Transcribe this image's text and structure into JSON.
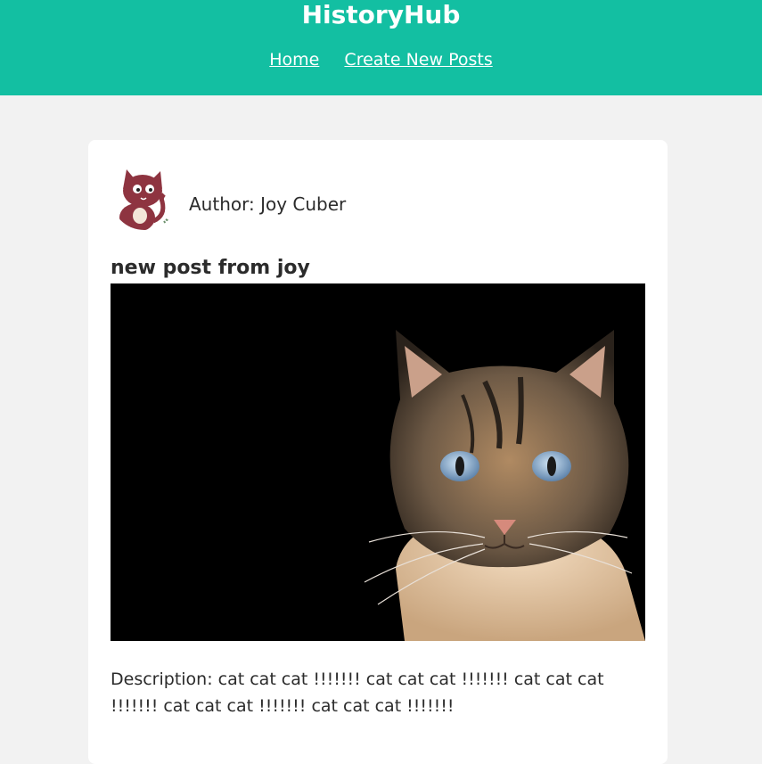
{
  "header": {
    "brand": "HistoryHub",
    "nav": {
      "home": "Home",
      "create": "Create New Posts"
    }
  },
  "post": {
    "author_line": "Author: Joy Cuber",
    "title": "new post from joy",
    "description": "Description: cat cat cat !!!!!!! cat cat cat !!!!!!! cat cat cat !!!!!!! cat cat cat !!!!!!! cat cat cat !!!!!!!"
  },
  "colors": {
    "header_bg": "#13bfa2",
    "page_bg": "#f2f2f2",
    "card_bg": "#ffffff",
    "text": "#2b2b2b"
  }
}
